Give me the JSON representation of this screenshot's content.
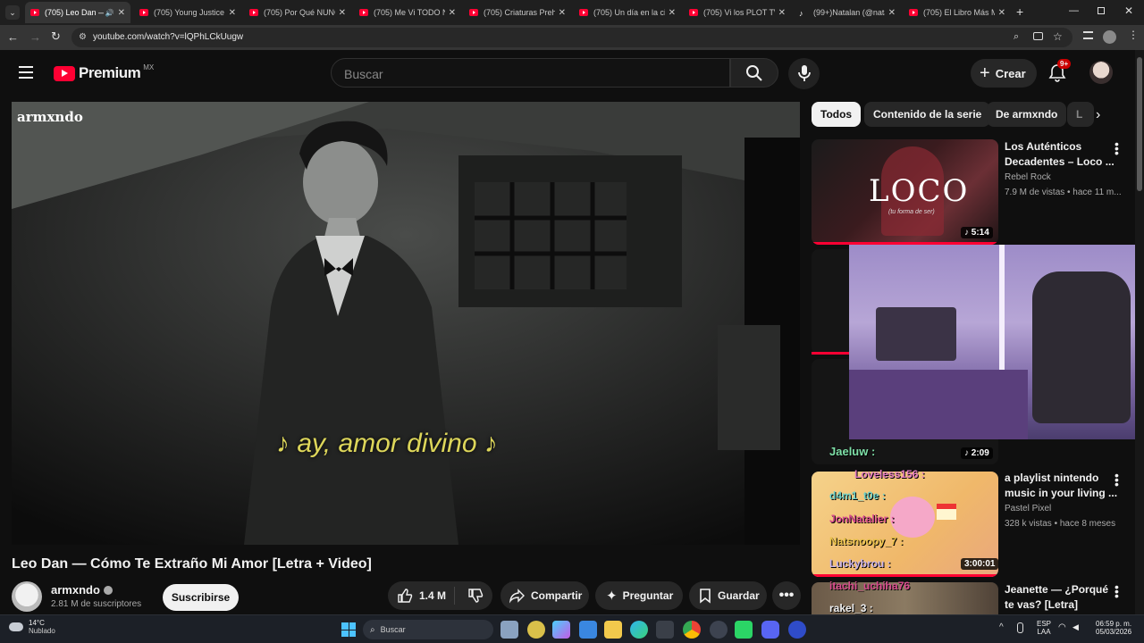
{
  "browser": {
    "tabs": [
      {
        "title": "(705) Leo Dan — ",
        "active": true,
        "icon": "youtube-icon"
      },
      {
        "title": "(705) Young Justice e",
        "active": false,
        "icon": "youtube-icon"
      },
      {
        "title": "(705) Por Qué NUNCA",
        "active": false,
        "icon": "youtube-icon"
      },
      {
        "title": "(705) Me Vi TODO Na",
        "active": false,
        "icon": "youtube-icon"
      },
      {
        "title": "(705) Criaturas Prehis",
        "active": false,
        "icon": "youtube-icon"
      },
      {
        "title": "(705) Un día en la ciu",
        "active": false,
        "icon": "youtube-icon"
      },
      {
        "title": "(705) Vi los PLOT TWI",
        "active": false,
        "icon": "youtube-icon"
      },
      {
        "title": "(99+)Natalan (@nata",
        "active": false,
        "icon": "tiktok-icon"
      },
      {
        "title": "(705) El Libro Más M",
        "active": false,
        "icon": "youtube-icon"
      }
    ],
    "url": "youtube.com/watch?v=lQPhLCkUugw"
  },
  "header": {
    "logo_text": "Premium",
    "region": "MX",
    "search_placeholder": "Buscar",
    "create_label": "Crear",
    "notif_count": "9+"
  },
  "player": {
    "watermark": "armxndo",
    "subtitle": "♪ ay, amor divino ♪"
  },
  "video": {
    "title": "Leo Dan — Cómo Te Extraño Mi Amor [Letra + Video]",
    "channel": "armxndo",
    "subscribers": "2.81 M de suscriptores",
    "subscribe_label": "Suscribirse",
    "likes": "1.4 M",
    "share_label": "Compartir",
    "ask_label": "Preguntar",
    "save_label": "Guardar"
  },
  "sidebar": {
    "chips": [
      "Todos",
      "Contenido de la serie",
      "De armxndo",
      "L"
    ],
    "recs": [
      {
        "title1": "Los Auténticos",
        "title2": "Decadentes – Loco ...",
        "channel": "Rebel Rock",
        "meta": "7.9 M de vistas • hace 11 m...",
        "duration": "5:14",
        "thumb_text": "LOCO",
        "thumb_sub": "(tu forma de ser)"
      },
      {
        "duration": "2:09"
      },
      {
        "title1": "a playlist nintendo",
        "title2": "music in your living ...",
        "channel": "Pastel Pixel",
        "meta": "328 k vistas • hace 8 meses",
        "duration": "3:00:01"
      },
      {
        "title1": "Jeanette — ¿Porqué",
        "title2": "te vas? [Letra]"
      }
    ]
  },
  "overlay_chat": {
    "lines": [
      "Jaeluw :",
      "Loveless156 :",
      "d4m1_t0e :",
      "JonNatalier :",
      "Natsnoopy_7 :",
      "Luckybrou :",
      "itachi_uchiha76",
      "rakel_3 :"
    ]
  },
  "taskbar": {
    "temp": "14°C",
    "weather": "Nublado",
    "search": "Buscar",
    "lang1": "ESP",
    "lang2": "LAA",
    "time": "06:59 p. m.",
    "date": "05/03/2026"
  }
}
